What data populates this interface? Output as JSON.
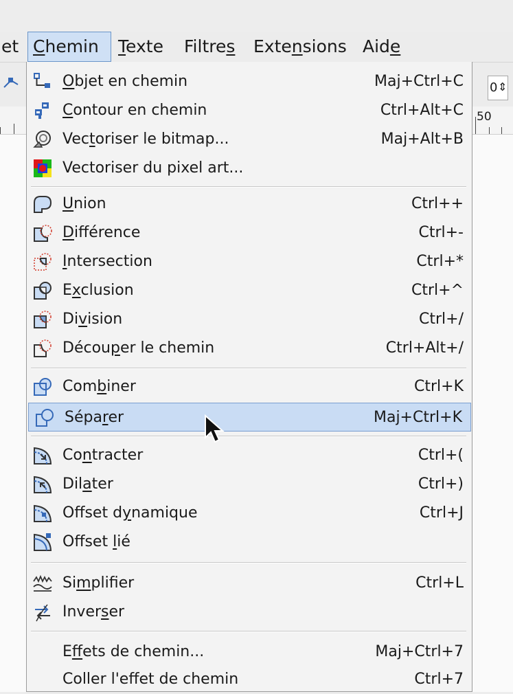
{
  "menubar": {
    "items": [
      {
        "id": "objet-partial",
        "text": "et"
      },
      {
        "id": "chemin",
        "pre": "",
        "u": "C",
        "post": "hemin"
      },
      {
        "id": "texte",
        "pre": "",
        "u": "T",
        "post": "exte"
      },
      {
        "id": "filtres",
        "pre": "Filtre",
        "u": "s",
        "post": ""
      },
      {
        "id": "extensions",
        "pre": "Exte",
        "u": "n",
        "post": "sions"
      },
      {
        "id": "aide",
        "pre": "Aid",
        "u": "e",
        "post": ""
      }
    ]
  },
  "toolbar": {
    "spin_value": "0",
    "spin_arrows": "⇕"
  },
  "ruler": {
    "label": "50"
  },
  "menu": {
    "items": [
      {
        "id": "objet-en-chemin",
        "pre": "",
        "u": "O",
        "post": "bjet en chemin",
        "shortcut": "Maj+Ctrl+C",
        "icon": "object-to-path-icon"
      },
      {
        "id": "contour-en-chemin",
        "pre": "",
        "u": "C",
        "post": "ontour en chemin",
        "shortcut": "Ctrl+Alt+C",
        "icon": "stroke-to-path-icon"
      },
      {
        "id": "vectoriser-bitmap",
        "pre": "Vec",
        "u": "t",
        "post": "oriser le bitmap...",
        "shortcut": "Maj+Alt+B",
        "icon": "trace-bitmap-icon"
      },
      {
        "id": "vectoriser-pixel-art",
        "pre": "Vectoriser du pixel art...",
        "u": "",
        "post": "",
        "shortcut": "",
        "icon": "trace-pixel-art-icon"
      },
      {
        "id": "union",
        "pre": "",
        "u": "U",
        "post": "nion",
        "shortcut": "Ctrl++",
        "icon": "union-icon"
      },
      {
        "id": "difference",
        "pre": "",
        "u": "D",
        "post": "ifférence",
        "shortcut": "Ctrl+-",
        "icon": "difference-icon"
      },
      {
        "id": "intersection",
        "pre": "",
        "u": "I",
        "post": "ntersection",
        "shortcut": "Ctrl+*",
        "icon": "intersection-icon"
      },
      {
        "id": "exclusion",
        "pre": "E",
        "u": "x",
        "post": "clusion",
        "shortcut": "Ctrl+^",
        "icon": "exclusion-icon"
      },
      {
        "id": "division",
        "pre": "Di",
        "u": "v",
        "post": "ision",
        "shortcut": "Ctrl+/",
        "icon": "division-icon"
      },
      {
        "id": "decouper",
        "pre": "Décou",
        "u": "p",
        "post": "er le chemin",
        "shortcut": "Ctrl+Alt+/",
        "icon": "cut-path-icon"
      },
      {
        "id": "combiner",
        "pre": "Com",
        "u": "b",
        "post": "iner",
        "shortcut": "Ctrl+K",
        "icon": "combine-icon"
      },
      {
        "id": "separer",
        "pre": "Sépa",
        "u": "r",
        "post": "er",
        "shortcut": "Maj+Ctrl+K",
        "icon": "break-apart-icon"
      },
      {
        "id": "contracter",
        "pre": "Co",
        "u": "n",
        "post": "tracter",
        "shortcut": "Ctrl+(",
        "icon": "inset-icon"
      },
      {
        "id": "dilater",
        "pre": "Dil",
        "u": "a",
        "post": "ter",
        "shortcut": "Ctrl+)",
        "icon": "outset-icon"
      },
      {
        "id": "offset-dynamique",
        "pre": "Offset d",
        "u": "y",
        "post": "namique",
        "shortcut": "Ctrl+J",
        "icon": "dynamic-offset-icon"
      },
      {
        "id": "offset-lie",
        "pre": "Offset ",
        "u": "l",
        "post": "ié",
        "shortcut": "",
        "icon": "linked-offset-icon"
      },
      {
        "id": "simplifier",
        "pre": "Si",
        "u": "m",
        "post": "plifier",
        "shortcut": "Ctrl+L",
        "icon": "simplify-icon"
      },
      {
        "id": "inverser",
        "pre": "Inver",
        "u": "s",
        "post": "er",
        "shortcut": "",
        "icon": "reverse-icon"
      },
      {
        "id": "effets-chemin",
        "pre": "E",
        "u": "f",
        "post": "fets de chemin...",
        "shortcut": "Maj+Ctrl+7",
        "icon": ""
      },
      {
        "id": "coller-effet",
        "pre": "Coller l'effet de chemin",
        "u": "",
        "post": "",
        "shortcut": "Ctrl+7",
        "icon": ""
      }
    ]
  },
  "colors": {
    "selection": "#c9dcf4",
    "selection_border": "#7a9ed0",
    "icon_blue": "#3569b8",
    "icon_red": "#d23a2a"
  }
}
